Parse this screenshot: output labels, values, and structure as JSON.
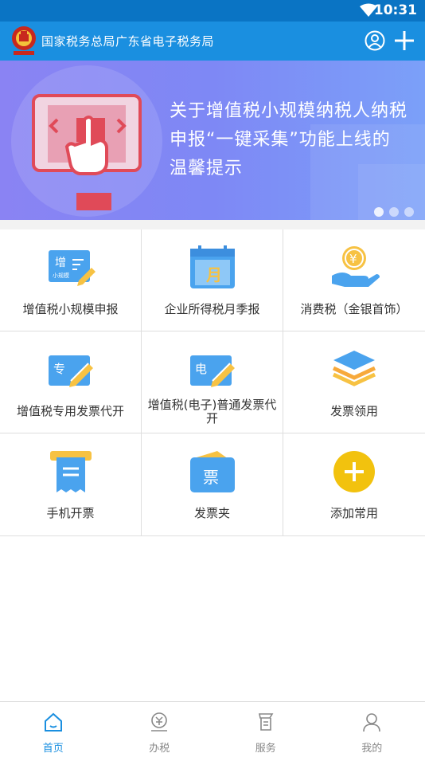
{
  "status_bar": {
    "time": "10:31"
  },
  "header": {
    "title": "国家税务总局广东省电子税务局",
    "icons": {
      "logo": "tax-emblem",
      "user": "user-circle-icon",
      "add": "plus-icon"
    }
  },
  "banner": {
    "headline": "关于增值税小规模纳税人纳税申报“一键采集”功能上线的温馨提示",
    "dot_count": 3,
    "active_dot": 1
  },
  "tiles": [
    {
      "label": "增值税小规模申报",
      "icon": "vat-small-scale-icon",
      "icon_text": "增",
      "icon_subtext": "小规模"
    },
    {
      "label": "企业所得税月季报",
      "icon": "calendar-month-icon",
      "icon_text": "月"
    },
    {
      "label": "消费税（金银首饰）",
      "icon": "coin-hand-icon",
      "icon_text": "¥"
    },
    {
      "label": "增值税专用发票代开",
      "icon": "special-invoice-icon",
      "icon_text": "专"
    },
    {
      "label": "增值税(电子)普通发票代开",
      "icon": "electronic-invoice-icon",
      "icon_text": "电"
    },
    {
      "label": "发票领用",
      "icon": "stacked-layers-icon"
    },
    {
      "label": "手机开票",
      "icon": "mobile-receipt-icon"
    },
    {
      "label": "发票夹",
      "icon": "invoice-folder-icon",
      "icon_text": "票"
    },
    {
      "label": "添加常用",
      "icon": "add-circle-icon",
      "icon_text": "+"
    }
  ],
  "bottom_nav": [
    {
      "label": "首页",
      "icon": "home-icon",
      "active": true
    },
    {
      "label": "办税",
      "icon": "tax-coin-icon",
      "active": false
    },
    {
      "label": "服务",
      "icon": "service-icon",
      "active": false
    },
    {
      "label": "我的",
      "icon": "profile-icon",
      "active": false
    }
  ],
  "colors": {
    "primary": "#1a8fe0",
    "statusbar": "#0a74c4",
    "icon_blue": "#4aa3ee",
    "icon_yellow": "#f7c243",
    "banner_red": "#e04a58"
  }
}
